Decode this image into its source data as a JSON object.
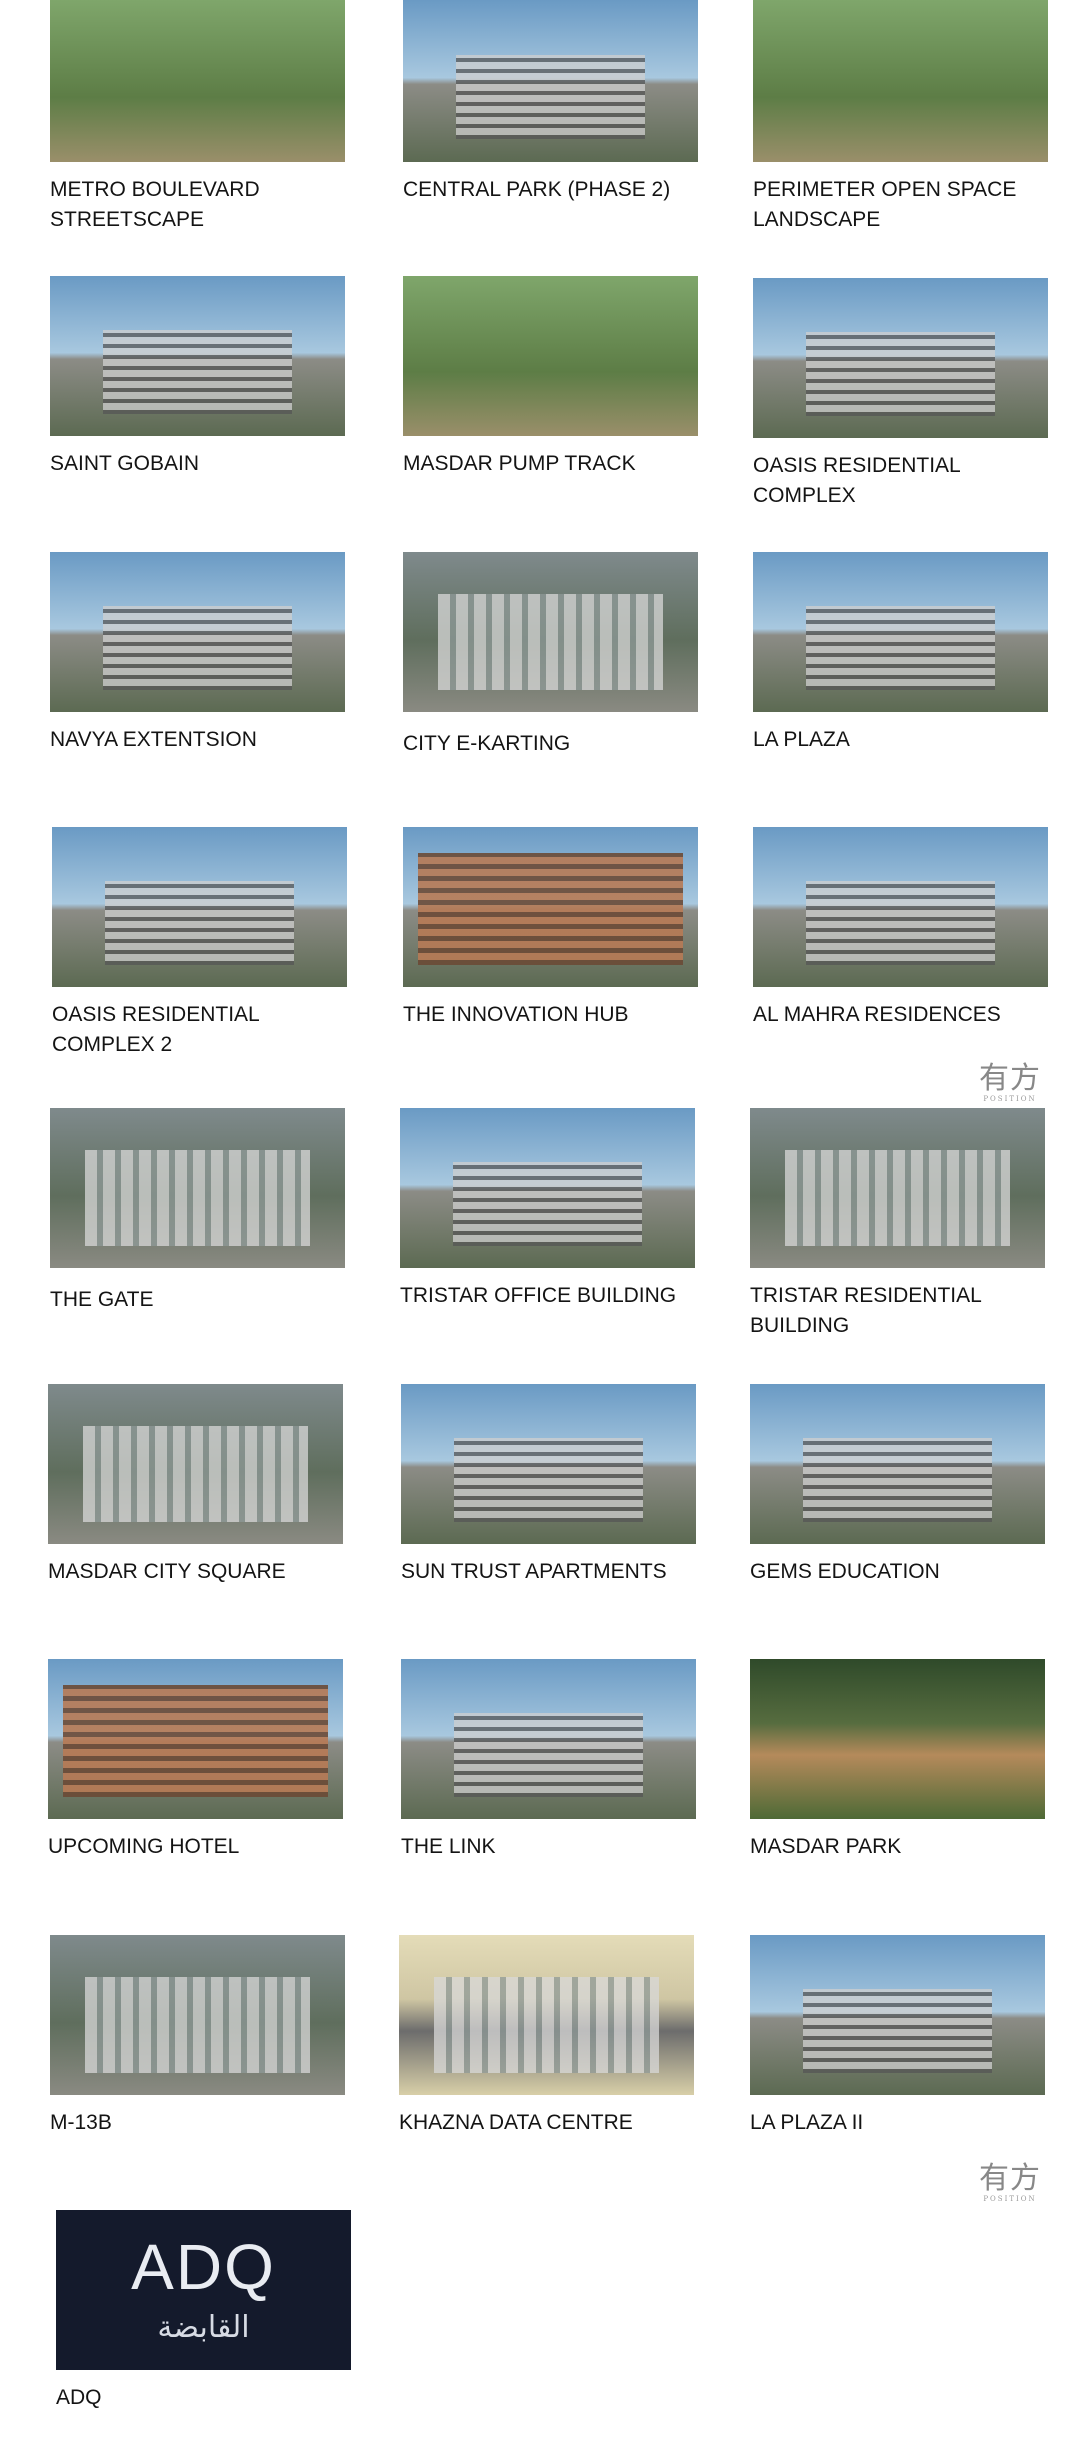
{
  "projects": [
    {
      "name": "METRO BOULEVARD STREETSCAPE",
      "img": "streetscape-photo"
    },
    {
      "name": "CENTRAL PARK (PHASE 2)",
      "img": "park-photo"
    },
    {
      "name": "PERIMETER OPEN SPACE LANDSCAPE",
      "img": "landscape-photo"
    },
    {
      "name": "SAINT GOBAIN",
      "img": "building-photo"
    },
    {
      "name": "MASDAR PUMP TRACK",
      "img": "pump-track-photo"
    },
    {
      "name": "OASIS RESIDENTIAL COMPLEX",
      "img": "building-photo"
    },
    {
      "name": "NAVYA EXTENTSION",
      "img": "building-photo"
    },
    {
      "name": "CITY E-KARTING",
      "img": "aerial-photo"
    },
    {
      "name": "LA PLAZA",
      "img": "building-photo"
    },
    {
      "name": "OASIS RESIDENTIAL COMPLEX 2",
      "img": "building-photo"
    },
    {
      "name": "THE INNOVATION HUB",
      "img": "building-photo"
    },
    {
      "name": "AL MAHRA RESIDENCES",
      "img": "building-photo"
    },
    {
      "name": "THE GATE",
      "img": "aerial-photo"
    },
    {
      "name": "TRISTAR OFFICE BUILDING",
      "img": "building-photo"
    },
    {
      "name": "TRISTAR RESIDENTIAL BUILDING",
      "img": "aerial-photo"
    },
    {
      "name": "MASDAR CITY SQUARE",
      "img": "aerial-photo"
    },
    {
      "name": "SUN TRUST APARTMENTS",
      "img": "building-photo"
    },
    {
      "name": "GEMS EDUCATION",
      "img": "building-photo"
    },
    {
      "name": "UPCOMING HOTEL",
      "img": "building-photo"
    },
    {
      "name": "THE LINK",
      "img": "building-photo"
    },
    {
      "name": "MASDAR PARK",
      "img": "park-photo"
    },
    {
      "name": "M-13B",
      "img": "aerial-photo"
    },
    {
      "name": "KHAZNA DATA CENTRE",
      "img": "aerial-photo"
    },
    {
      "name": "LA PLAZA II",
      "img": "building-photo"
    },
    {
      "name": "ADQ",
      "img": "adq-logo"
    }
  ],
  "adq_logo": {
    "mark": "ADQ",
    "arabic": "القابضة"
  },
  "watermark": {
    "cn": "有方",
    "en": "POSITION"
  }
}
